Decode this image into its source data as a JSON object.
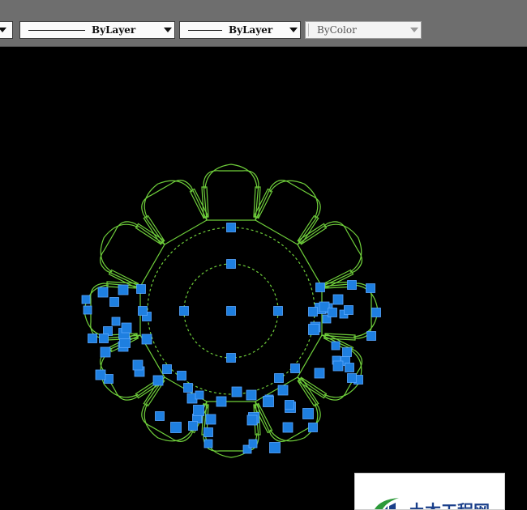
{
  "toolbar": {
    "linetype_value": "ByLayer",
    "lineweight_value": "ByLayer",
    "plotstyle_value": "ByColor"
  },
  "watermark": {
    "text": "土木工程网"
  },
  "colors": {
    "geometry": "#6fcf3b",
    "grip": "#1e7fe0",
    "background": "#000000",
    "toolbar": "#6e6e6e"
  }
}
